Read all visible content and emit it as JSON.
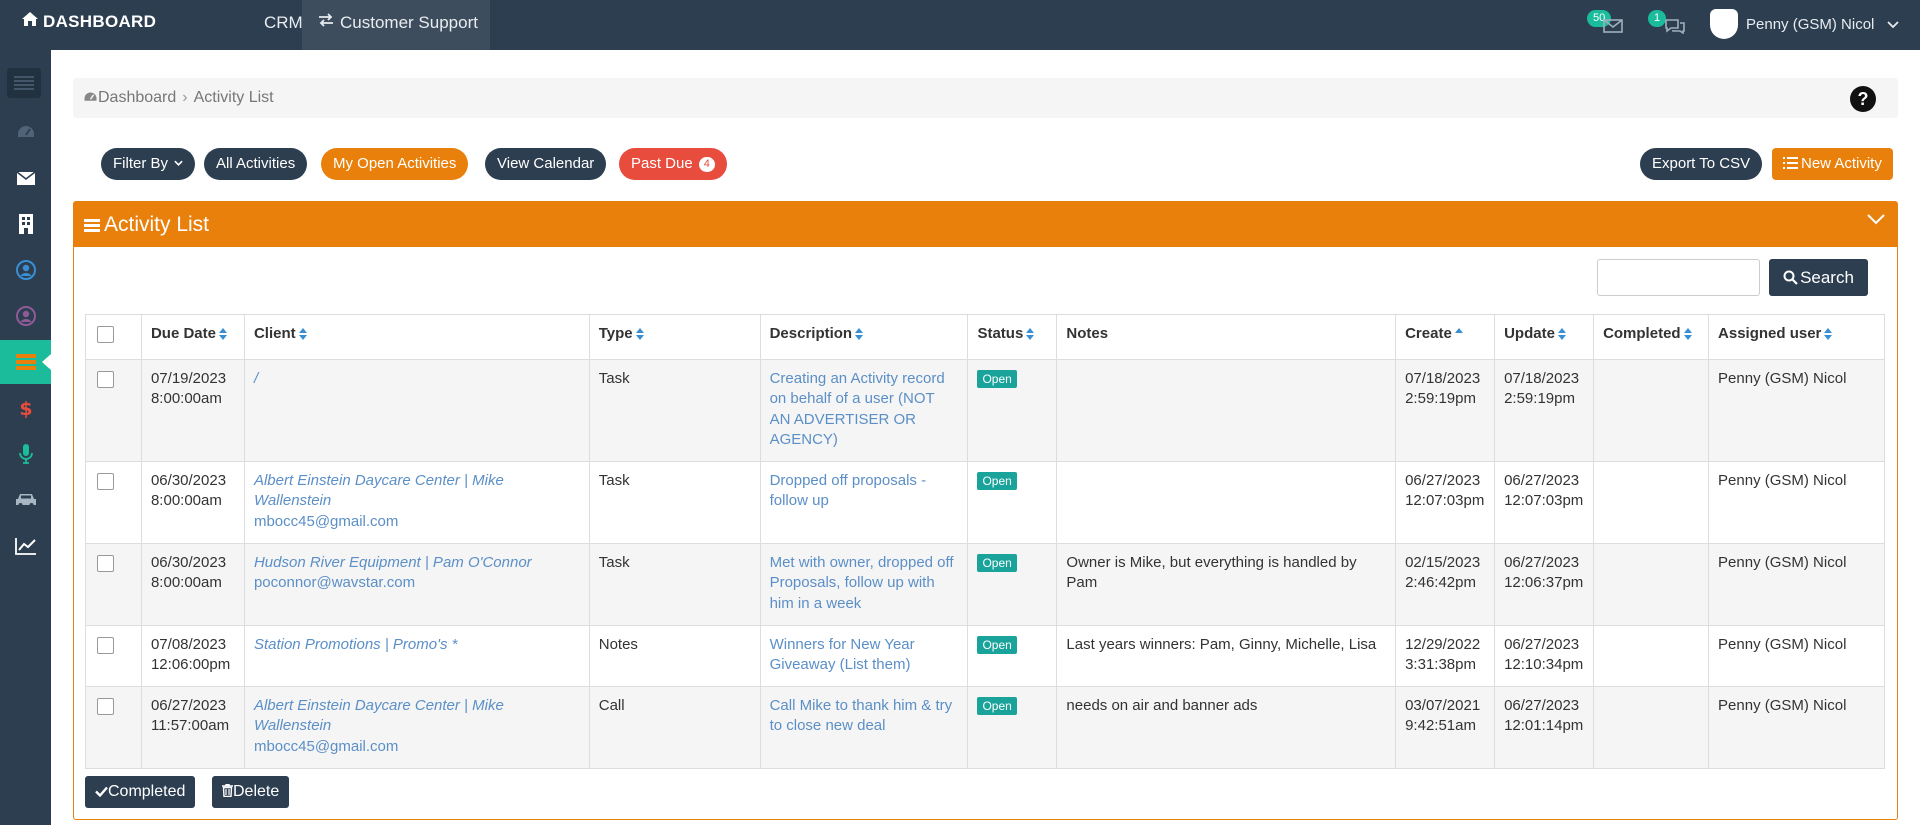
{
  "topbar": {
    "brand": "DASHBOARD",
    "nav_crm": "CRM",
    "nav_customer_support": "Customer Support",
    "mail_badge": "50",
    "chat_badge": "1",
    "user_name": "Penny (GSM) Nicol"
  },
  "sidebar": {
    "items": [
      {
        "icon": "dashboard-icon"
      },
      {
        "icon": "envelope-icon"
      },
      {
        "icon": "building-icon"
      },
      {
        "icon": "user-circle-icon"
      },
      {
        "icon": "user-circle-icon"
      },
      {
        "icon": "activity-list-icon",
        "active": true
      },
      {
        "icon": "dollar-icon"
      },
      {
        "icon": "microphone-icon"
      },
      {
        "icon": "car-icon"
      },
      {
        "icon": "chart-line-icon"
      }
    ]
  },
  "breadcrumb": {
    "home": "Dashboard",
    "current": "Activity List"
  },
  "actions": {
    "filter_by": "Filter By",
    "all_activities": "All Activities",
    "my_open_activities": "My Open Activities",
    "view_calendar": "View Calendar",
    "past_due": "Past Due",
    "past_due_count": "4",
    "export_csv": "Export To CSV",
    "new_activity": "New Activity"
  },
  "panel": {
    "title": "Activity List",
    "search_label": "Search"
  },
  "table": {
    "columns": [
      "Due Date",
      "Client",
      "Type",
      "Description",
      "Status",
      "Notes",
      "Create",
      "Update",
      "Completed",
      "Assigned user"
    ],
    "rows": [
      {
        "due_date": "07/19/2023",
        "due_time": "8:00:00am",
        "client": "/",
        "client_email": "",
        "type": "Task",
        "description": "Creating an Activity record on behalf of a user (NOT AN ADVERTISER OR AGENCY)",
        "status": "Open",
        "notes": "",
        "create_date": "07/18/2023",
        "create_time": "2:59:19pm",
        "update_date": "07/18/2023",
        "update_time": "2:59:19pm",
        "completed": "",
        "assigned": "Penny (GSM) Nicol"
      },
      {
        "due_date": "06/30/2023",
        "due_time": "8:00:00am",
        "client": "Albert Einstein Daycare Center | Mike Wallenstein",
        "client_email": "mbocc45@gmail.com",
        "type": "Task",
        "description": "Dropped off proposals - follow up",
        "status": "Open",
        "notes": "",
        "create_date": "06/27/2023",
        "create_time": "12:07:03pm",
        "update_date": "06/27/2023",
        "update_time": "12:07:03pm",
        "completed": "",
        "assigned": "Penny (GSM) Nicol"
      },
      {
        "due_date": "06/30/2023",
        "due_time": "8:00:00am",
        "client": "Hudson River Equipment | Pam O'Connor",
        "client_email": "poconnor@wavstar.com",
        "type": "Task",
        "description": "Met with owner, dropped off Proposals, follow up with him in a week",
        "status": "Open",
        "notes": "Owner is Mike, but everything is handled by Pam",
        "create_date": "02/15/2023",
        "create_time": "2:46:42pm",
        "update_date": "06/27/2023",
        "update_time": "12:06:37pm",
        "completed": "",
        "assigned": "Penny (GSM) Nicol"
      },
      {
        "due_date": "07/08/2023",
        "due_time": "12:06:00pm",
        "client": "Station Promotions | Promo's *",
        "client_email": "",
        "type": "Notes",
        "description": "Winners for New Year Giveaway (List them)",
        "status": "Open",
        "notes": "Last years winners: Pam, Ginny, Michelle, Lisa",
        "create_date": "12/29/2022",
        "create_time": "3:31:38pm",
        "update_date": "06/27/2023",
        "update_time": "12:10:34pm",
        "completed": "",
        "assigned": "Penny (GSM) Nicol"
      },
      {
        "due_date": "06/27/2023",
        "due_time": "11:57:00am",
        "client": "Albert Einstein Daycare Center | Mike Wallenstein",
        "client_email": "mbocc45@gmail.com",
        "type": "Call",
        "description": "Call Mike to thank him & try to close new deal",
        "status": "Open",
        "notes": "needs on air and banner ads",
        "create_date": "03/07/2021",
        "create_time": "9:42:51am",
        "update_date": "06/27/2023",
        "update_time": "12:01:14pm",
        "completed": "",
        "assigned": "Penny (GSM) Nicol"
      }
    ]
  },
  "footer": {
    "completed_btn": "Completed",
    "delete_btn": "Delete"
  },
  "colors": {
    "navbar": "#2c3e50",
    "accent_orange": "#e8800b",
    "active_teal": "#1abc9c",
    "danger_red": "#e74c3c",
    "link_blue": "#5b8fc7",
    "status_teal": "#1aa39a"
  }
}
